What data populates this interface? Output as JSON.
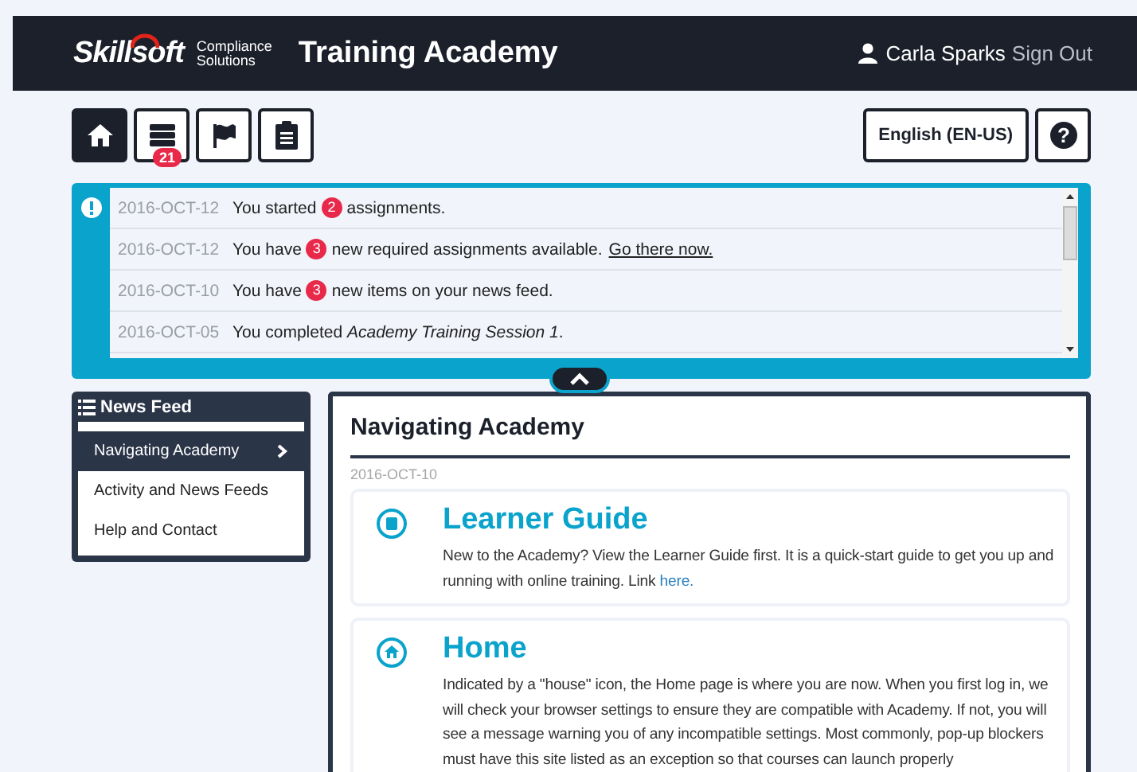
{
  "header": {
    "logo": "Skillsoft",
    "logo_subtitle": "Compliance Solutions",
    "title": "Training Academy",
    "user": "Carla Sparks",
    "sign_out": "Sign Out"
  },
  "toolbar": {
    "buttons": [
      {
        "kind": "home",
        "selected": true
      },
      {
        "kind": "list",
        "selected": false,
        "badge": "21"
      },
      {
        "kind": "flag",
        "selected": false
      },
      {
        "kind": "clipboard",
        "selected": false
      }
    ],
    "language": "English (EN-US)",
    "help": "?"
  },
  "notifications": [
    {
      "date": "2016-OCT-12",
      "before": "You started",
      "count": "2",
      "after": "assignments."
    },
    {
      "date": "2016-OCT-12",
      "before": "You have",
      "count": "3",
      "after": "new required assignments available.",
      "link": "Go there now."
    },
    {
      "date": "2016-OCT-10",
      "before": "You have",
      "count": "3",
      "after": "new items on your news feed."
    },
    {
      "date": "2016-OCT-05",
      "before": "You completed *Academy Training Session 1*."
    }
  ],
  "sidebar": {
    "title": "News Feed",
    "items": [
      {
        "label": "Navigating Academy",
        "selected": true
      },
      {
        "label": "Activity and News Feeds",
        "selected": false
      },
      {
        "label": "Help and Contact",
        "selected": false
      }
    ]
  },
  "article": {
    "title": "Navigating Academy",
    "date": "2016-OCT-10",
    "sections": [
      {
        "kind": "guide",
        "title": "Learner Guide",
        "text": "New to the Academy? View the Learner Guide first. It is a quick-start guide to get you up and running with online training. Link",
        "link": "here."
      },
      {
        "kind": "home",
        "title": "Home",
        "text": "Indicated by a \"house\" icon, the Home page is where you are now. When you first log in, we will check your browser settings to ensure they are compatible with Academy. If not, you will see a message warning you of any incompatible settings. Most commonly, pop-up blockers must have this site listed as an exception so that courses can launch properly"
      }
    ]
  }
}
